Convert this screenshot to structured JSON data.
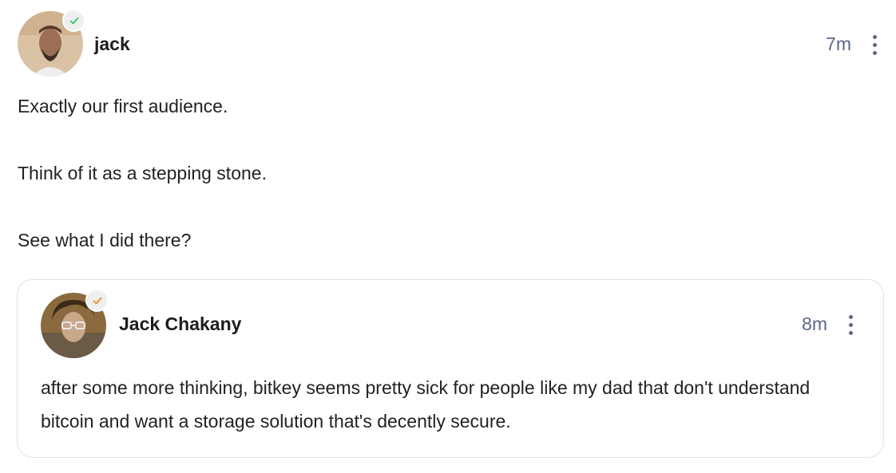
{
  "post": {
    "author": "jack",
    "time": "7m",
    "verified_icon": "check-icon",
    "verified_color": "#35c268",
    "paragraphs": [
      "Exactly our first audience.",
      "Think of it as a stepping stone.",
      "See what I did there?"
    ]
  },
  "quoted_post": {
    "author": "Jack Chakany",
    "time": "8m",
    "verified_icon": "check-icon",
    "verified_color": "#f08a24",
    "text": "after some more thinking, bitkey seems pretty sick for people like my dad that don't understand bitcoin and want a storage solution that's decently secure."
  },
  "colors": {
    "text": "#222222",
    "muted": "#5a6786",
    "border": "#e2e2e6"
  }
}
